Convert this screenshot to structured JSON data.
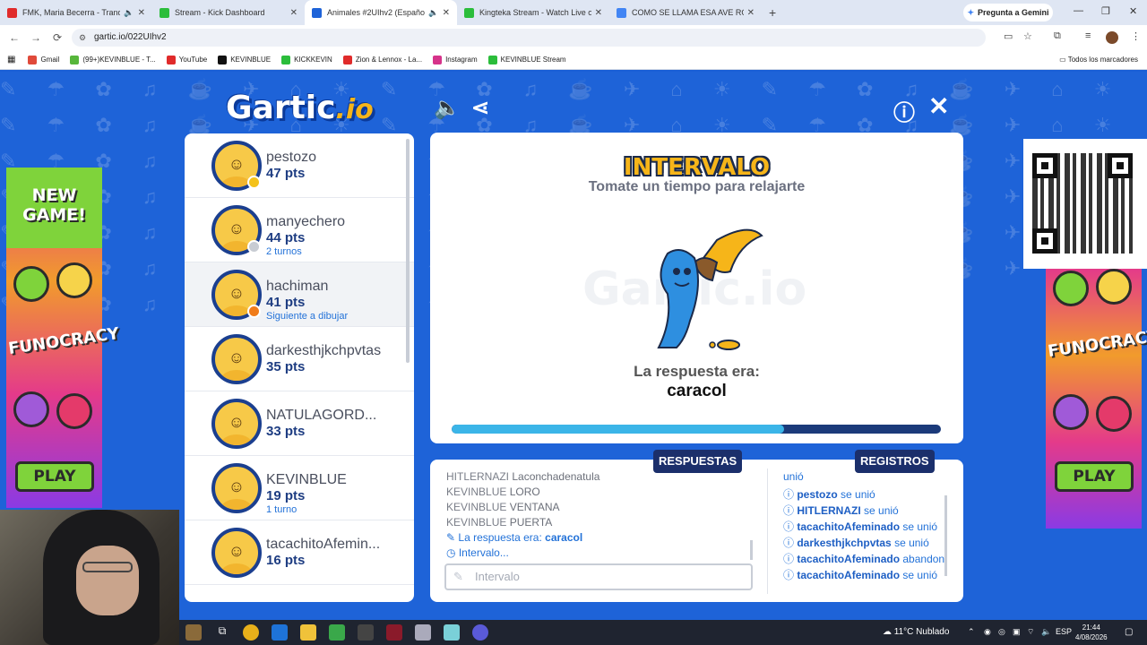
{
  "browser": {
    "tabs": [
      {
        "title": "FMK, Maria Becerra - Tranq",
        "color": "#e02b2b",
        "audio": true
      },
      {
        "title": "Stream - Kick Dashboard",
        "color": "#2bbd3b",
        "audio": false
      },
      {
        "title": "Animales #2UIhv2 (Españo",
        "color": "#1e63d8",
        "audio": true,
        "active": true
      },
      {
        "title": "Kingteka Stream - Watch Live o",
        "color": "#2bbd3b",
        "audio": false
      },
      {
        "title": "COMO SE LLAMA ESA AVE ROS",
        "color": "#4285f4",
        "audio": false
      }
    ],
    "gemini_label": "Pregunta a Gemini",
    "url": "gartic.io/022UIhv2",
    "bookmarks": [
      {
        "label": "Gmail",
        "color": "#e04a3a"
      },
      {
        "label": "(99+)KEVINBLUE - T...",
        "color": "#57b63b"
      },
      {
        "label": "YouTube",
        "color": "#e02b2b"
      },
      {
        "label": "KEVINBLUE",
        "color": "#111111"
      },
      {
        "label": "KICKKEVIN",
        "color": "#2bbd3b"
      },
      {
        "label": "Zion & Lennox - La...",
        "color": "#e02b2b"
      },
      {
        "label": "Instagram",
        "color": "#d6338a"
      },
      {
        "label": "KEVINBLUE Stream",
        "color": "#2bbd3b"
      }
    ],
    "all_bookmarks": "Todos los marcadores"
  },
  "game": {
    "logo_main": "Gartic",
    "logo_suffix": ".io",
    "players": [
      {
        "name": "pestozo",
        "pts": "47 pts",
        "sub": "",
        "dot": "#f4c21a",
        "highlight": false
      },
      {
        "name": "manyechero",
        "pts": "44 pts",
        "sub": "2 turnos",
        "dot": "#c8ccd3",
        "highlight": false
      },
      {
        "name": "hachiman",
        "pts": "41 pts",
        "sub": "Siguiente a dibujar",
        "dot": "#f07c1a",
        "highlight": true
      },
      {
        "name": "darkesthjkchpvtas",
        "pts": "35 pts",
        "sub": "",
        "dot": "",
        "highlight": false
      },
      {
        "name": "NATULAGORD...",
        "pts": "33 pts",
        "sub": "",
        "dot": "",
        "highlight": false
      },
      {
        "name": "KEVINBLUE",
        "pts": "19 pts",
        "sub": "1 turno",
        "dot": "",
        "highlight": false
      },
      {
        "name": "tacachitoAfemin...",
        "pts": "16 pts",
        "sub": "",
        "dot": "",
        "highlight": false
      }
    ],
    "stage": {
      "title": "INTERVALO",
      "subtitle": "Tomate un tiempo para relajarte",
      "watermark": "Gartic.io",
      "answer_label": "La respuesta era:",
      "answer": "caracol",
      "timer_fraction": 0.68
    },
    "chat": {
      "respuestas_label": "RESPUESTAS",
      "registros_label": "REGISTROS",
      "answers": [
        {
          "user": "HITLERNAZI",
          "text": "Laconchadenatula"
        },
        {
          "user": "KEVINBLUE",
          "text": "LORO"
        },
        {
          "user": "KEVINBLUE",
          "text": "VENTANA"
        },
        {
          "user": "KEVINBLUE",
          "text": "PUERTA"
        }
      ],
      "reveal_prefix": "La respuesta era:",
      "reveal_word": "caracol",
      "interval_msg": "Intervalo...",
      "input_placeholder": "Intervalo",
      "logs": [
        {
          "user": "",
          "action": "unió"
        },
        {
          "user": "pestozo",
          "action": "se unió"
        },
        {
          "user": "HITLERNAZI",
          "action": "se unió"
        },
        {
          "user": "tacachitoAfeminado",
          "action": "se unió"
        },
        {
          "user": "darkesthjkchpvtas",
          "action": "se unió"
        },
        {
          "user": "tacachitoAfeminado",
          "action": "abandonó"
        },
        {
          "user": "tacachitoAfeminado",
          "action": "se unió"
        }
      ]
    },
    "ads": {
      "new_game": "NEW GAME!",
      "brand": "FUNOCRACY",
      "play": "PLAY"
    }
  },
  "taskbar": {
    "weather": "11°C  Nublado",
    "lang": "ESP",
    "time": "21:44",
    "date": "4/08/2026"
  }
}
